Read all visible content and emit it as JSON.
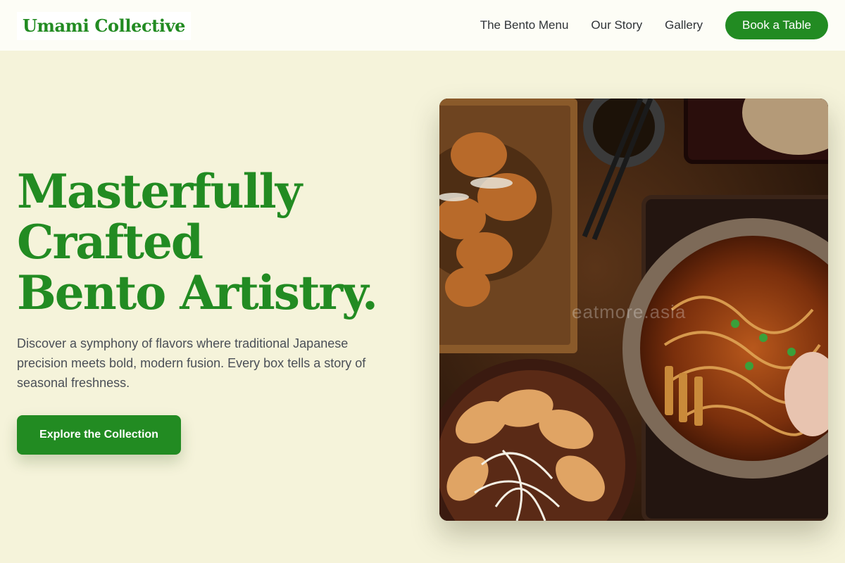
{
  "header": {
    "brand": "Umami Collective",
    "nav": [
      {
        "label": "The Bento Menu"
      },
      {
        "label": "Our Story"
      },
      {
        "label": "Gallery"
      }
    ],
    "book_label": "Book a Table"
  },
  "hero": {
    "headline": [
      "Masterfully",
      "Crafted",
      "Bento Artistry."
    ],
    "description": "Discover a symphony of flavors where traditional Japanese precision meets bold, modern fusion. Every box tells a story of seasonal freshness.",
    "cta_label": "Explore the Collection"
  },
  "photo": {
    "watermark": "eatmore.asia"
  },
  "colors": {
    "accent": "#228b22",
    "page_background": "#f5f3da",
    "header_background": "#fdfdf6",
    "body_text": "#4a4f57"
  }
}
